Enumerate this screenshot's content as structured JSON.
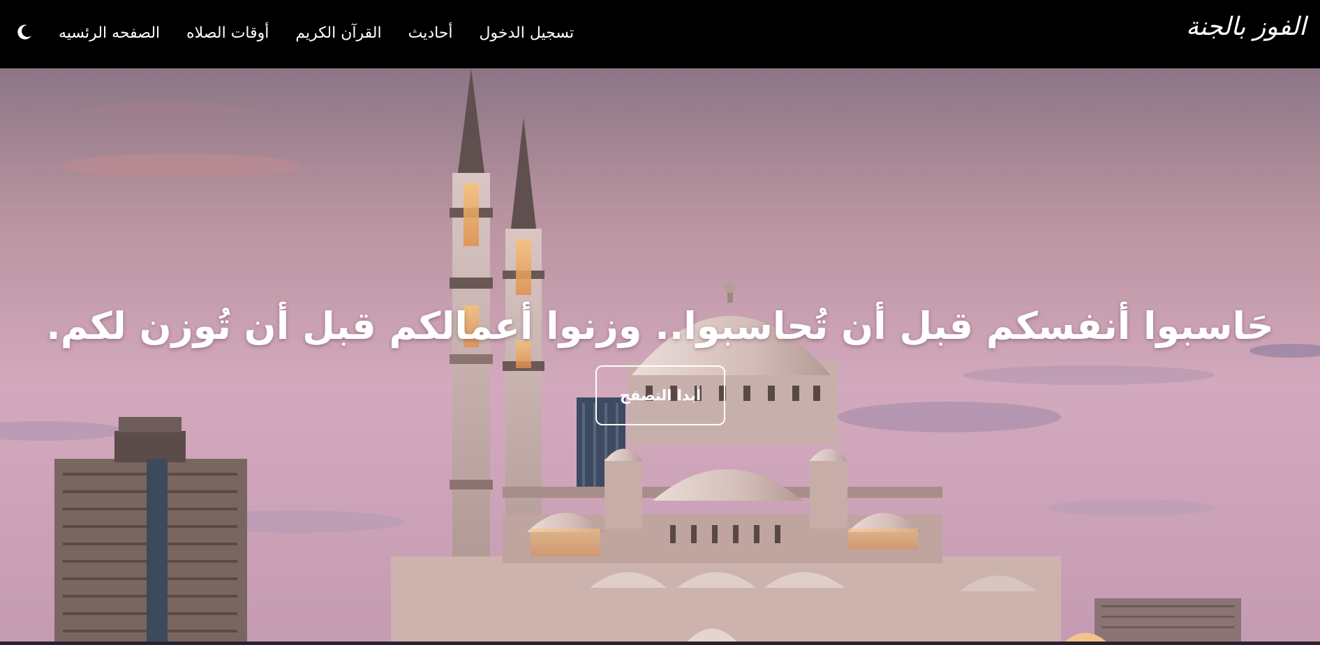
{
  "navbar": {
    "brand": "الفوز بالجنة",
    "links": [
      {
        "label": "الصفحه الرئسيه"
      },
      {
        "label": "أوقات الصلاه"
      },
      {
        "label": "القرآن الكريم"
      },
      {
        "label": "أحاديث"
      },
      {
        "label": "تسجيل الدخول"
      }
    ],
    "theme_icon": "crescent-moon-icon"
  },
  "hero": {
    "heading": "حَاسبوا أنفسكم قبل أن تُحاسبوا.. وزنوا أعمالكم قبل أن تُوزن لكم.",
    "button_label": "أبدا التصفح",
    "background_image": "mosque-at-sunset-photo"
  },
  "colors": {
    "navbar_bg": "#000000",
    "text": "#ffffff",
    "sky_top": "#8e7888",
    "sky_mid": "#d0a6ba",
    "sky_bottom": "#c79eb4"
  }
}
